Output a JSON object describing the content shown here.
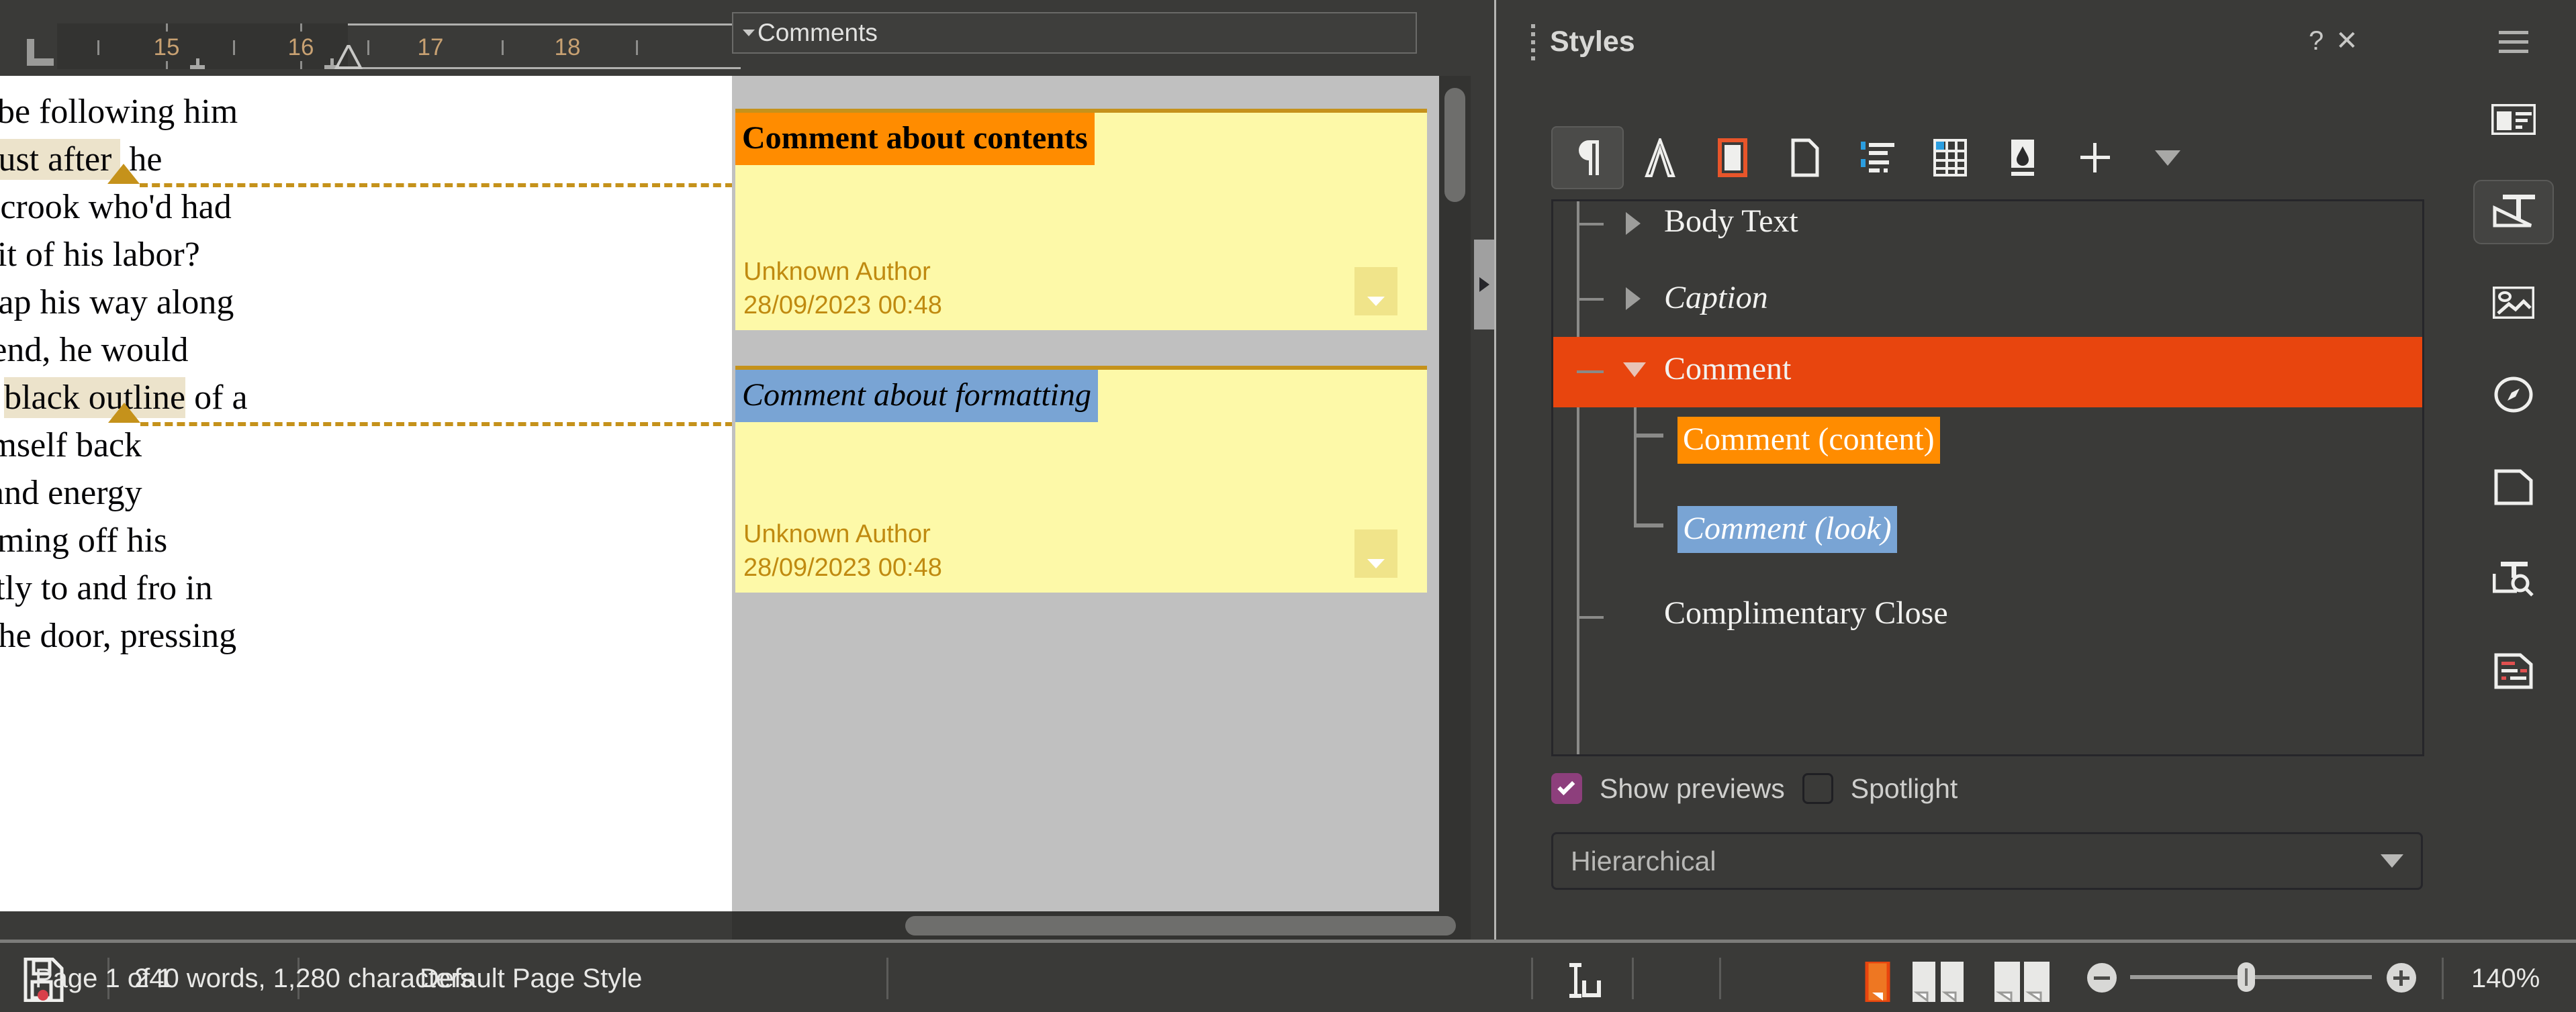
{
  "ruler": {
    "unit_numbers": [
      "15",
      "16",
      "17",
      "18"
    ],
    "tab_icon": "tab-stop-left-icon"
  },
  "comments_toolbar": {
    "label": "Comments",
    "caret_icon": "chevron-down-icon"
  },
  "document": {
    "lines": [
      "be following him",
      "just after| he",
      "r crook who'd had",
      "uit of his labor?",
      " tap his way along",
      "-end, he would",
      "e black outline| of a",
      "imself back",
      " and energy",
      "oming off his",
      "etly to and fro in",
      " the door, pressing"
    ],
    "highlighted_phrases": [
      "just after",
      "black outline"
    ]
  },
  "comments": [
    {
      "caption": "Comment about contents",
      "caption_style": "content",
      "author": "Unknown Author",
      "timestamp": "28/09/2023 00:48",
      "menu_icon": "chevron-down-icon"
    },
    {
      "caption": "Comment about formatting",
      "caption_style": "look",
      "author": "Unknown Author",
      "timestamp": "28/09/2023 00:48",
      "menu_icon": "chevron-down-icon"
    }
  ],
  "styles_panel": {
    "title": "Styles",
    "help_label": "?",
    "close_label": "✕",
    "toolbar": [
      {
        "name": "paragraph-styles",
        "icon": "pilcrow-icon",
        "active": false
      },
      {
        "name": "character-styles",
        "icon": "letter-a-icon",
        "active": false
      },
      {
        "name": "frame-styles",
        "icon": "frame-icon",
        "active": true
      },
      {
        "name": "page-styles",
        "icon": "page-icon",
        "active": false
      },
      {
        "name": "list-styles",
        "icon": "list-icon",
        "active": false
      },
      {
        "name": "table-styles",
        "icon": "table-icon",
        "active": false
      },
      {
        "name": "fill-format-mode",
        "icon": "paint-can-icon",
        "active": false
      },
      {
        "name": "new-style-from-selection",
        "icon": "plus-icon",
        "active": false
      },
      {
        "name": "style-actions-dropdown",
        "icon": "chevron-down-icon",
        "active": false
      }
    ],
    "list": [
      {
        "label": "Body Text",
        "level": 1,
        "twisty": "closed",
        "selected": false,
        "chip": "none",
        "italic": false,
        "clipped": true
      },
      {
        "label": "Caption",
        "level": 1,
        "twisty": "closed",
        "selected": false,
        "chip": "none",
        "italic": true,
        "clipped": false
      },
      {
        "label": "Comment",
        "level": 1,
        "twisty": "open",
        "selected": true,
        "chip": "none",
        "italic": false,
        "clipped": false
      },
      {
        "label": "Comment (content)",
        "level": 2,
        "twisty": "none",
        "selected": false,
        "chip": "orange",
        "italic": false,
        "clipped": false
      },
      {
        "label": "Comment (look)",
        "level": 2,
        "twisty": "none",
        "selected": false,
        "chip": "blue",
        "italic": true,
        "clipped": false
      },
      {
        "label": "Complimentary Close",
        "level": 1,
        "twisty": "none",
        "selected": false,
        "chip": "none",
        "italic": false,
        "clipped": false
      }
    ],
    "show_previews": {
      "label": "Show previews",
      "checked": true
    },
    "spotlight": {
      "label": "Spotlight",
      "checked": false
    },
    "filter": {
      "value": "Hierarchical",
      "arrow_icon": "chevron-down-icon"
    }
  },
  "sidebar_rail": [
    {
      "name": "sidebar-settings",
      "icon": "hamburger-menu-icon",
      "active": false
    },
    {
      "name": "properties-deck",
      "icon": "properties-icon",
      "active": false
    },
    {
      "name": "styles-deck",
      "icon": "styles-icon",
      "active": true
    },
    {
      "name": "gallery-deck",
      "icon": "gallery-image-icon",
      "active": false
    },
    {
      "name": "navigator-deck",
      "icon": "compass-icon",
      "active": false
    },
    {
      "name": "page-deck",
      "icon": "page-icon",
      "active": false
    },
    {
      "name": "style-inspector-deck",
      "icon": "style-inspector-icon",
      "active": false
    },
    {
      "name": "manage-changes-deck",
      "icon": "manage-changes-icon",
      "active": false
    }
  ],
  "statusbar": {
    "save_icon": "save-modified-icon",
    "page_info": "Page 1 of 1",
    "word_count": "240 words, 1,280 characters",
    "page_style": "Default Page Style",
    "selection_mode_icon": "text-selection-mode-icon",
    "views": [
      {
        "name": "single-page-view",
        "active": true
      },
      {
        "name": "multi-page-view",
        "active": false
      },
      {
        "name": "book-view",
        "active": false
      }
    ],
    "zoom_out_icon": "zoom-out-icon",
    "zoom_in_icon": "zoom-in-icon",
    "zoom_level": "140%"
  },
  "colors": {
    "accent_orange": "#e8450e",
    "comment_content_chip": "#ff8c00",
    "comment_look_chip": "#79a4d4",
    "comment_note_bg": "#fdf9a8",
    "comment_border": "#c5921b",
    "checkbox_on": "#8d3f7c",
    "panel_bg": "#3a3a38"
  }
}
